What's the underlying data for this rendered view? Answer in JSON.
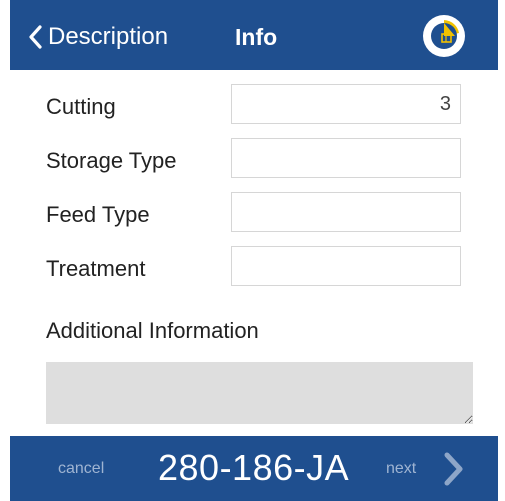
{
  "header": {
    "back_label": "Description",
    "title": "Info",
    "logo_icon": "app-logo-icon"
  },
  "form": {
    "fields": [
      {
        "label": "Cutting",
        "value": "3"
      },
      {
        "label": "Storage Type",
        "value": ""
      },
      {
        "label": "Feed Type",
        "value": ""
      },
      {
        "label": "Treatment",
        "value": ""
      }
    ],
    "additional_label": "Additional Information",
    "additional_value": ""
  },
  "footer": {
    "cancel_label": "cancel",
    "tag_id": "280-186-JA",
    "next_label": "next"
  },
  "colors": {
    "header_bg": "#1f4f8f",
    "accent_yellow": "#f2c200"
  }
}
